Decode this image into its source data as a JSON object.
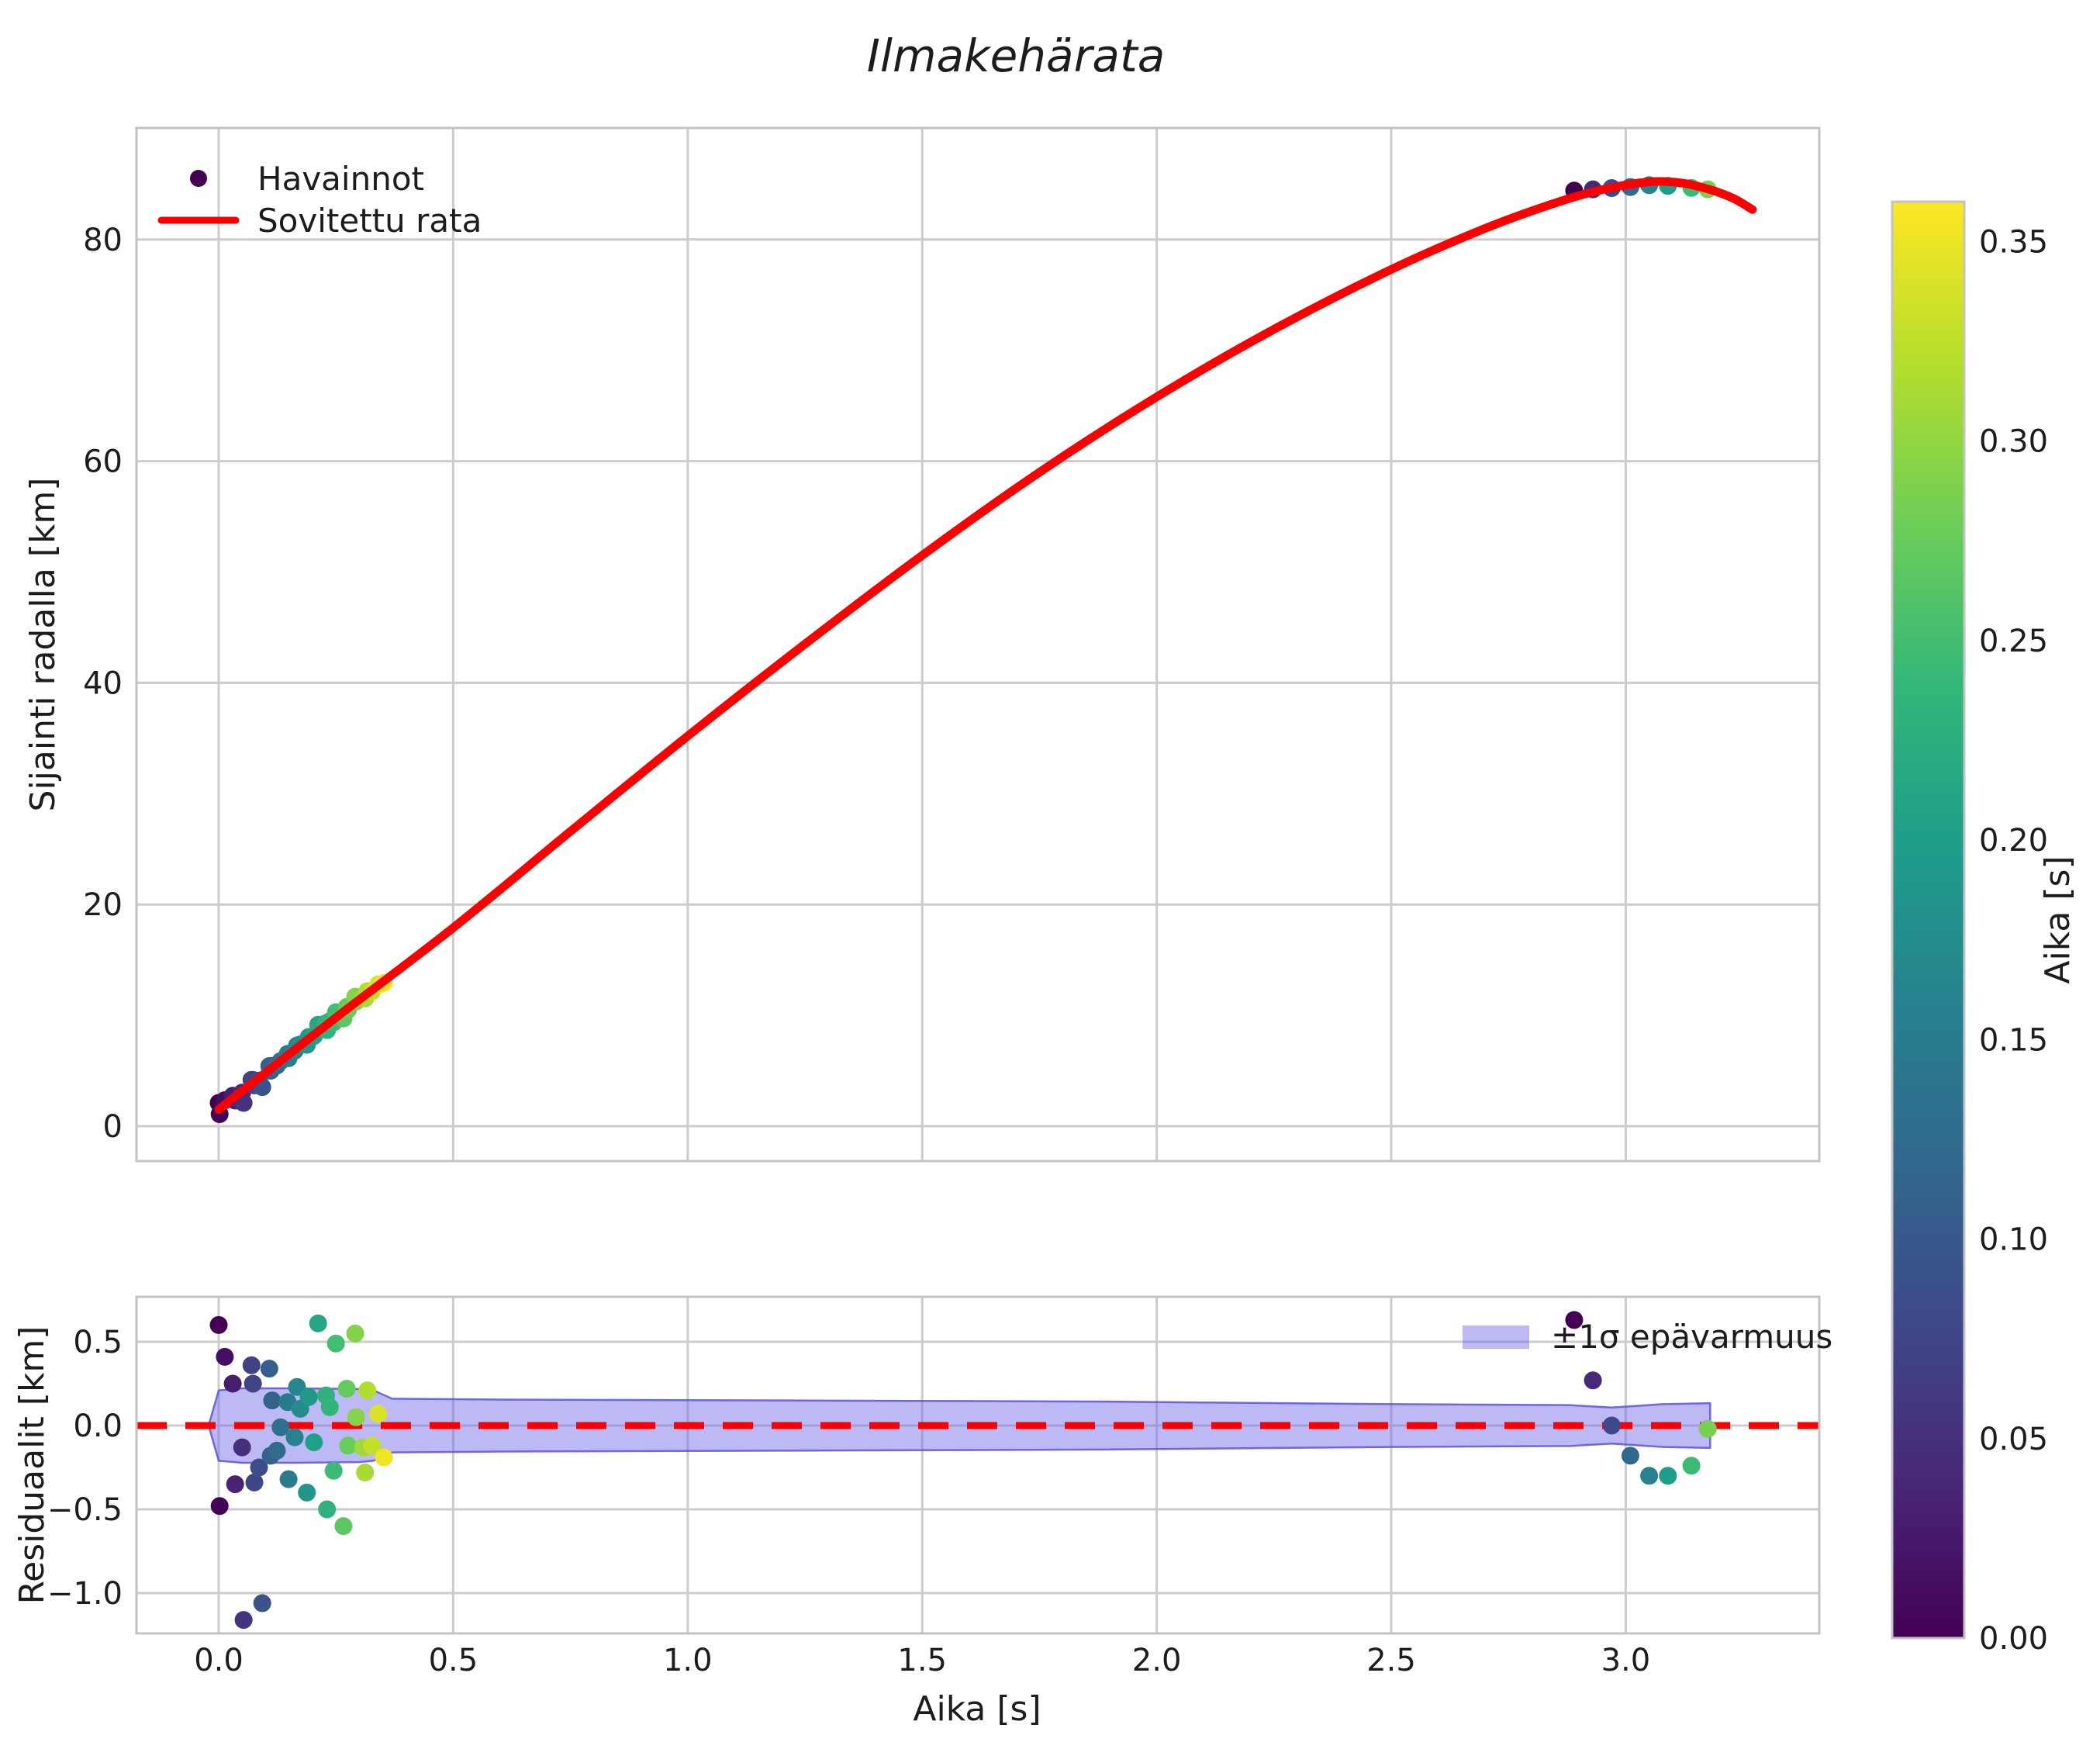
{
  "title": "Ilmakehärata",
  "colors": {
    "fit_line": "#fa0000",
    "zero_line": "#fa0000",
    "band_fill": "#6a63e8",
    "band_edge": "#5b52e0",
    "grid": "#cccccc",
    "spine": "#c3c3c3",
    "text": "#1c1c1c",
    "legend_marker": "#440154",
    "background": "#ffffff"
  },
  "chart_data": [
    {
      "type": "scatter",
      "panel": "trajectory",
      "ylabel": "Sijainti radalla [km]",
      "xlim": [
        -0.18,
        3.41
      ],
      "ylim": [
        -3.1,
        90.1
      ],
      "xticks": [
        0.0,
        0.5,
        1.0,
        1.5,
        2.0,
        2.5,
        3.0
      ],
      "xtick_labels": [],
      "yticks": [
        0,
        20,
        40,
        60,
        80
      ],
      "ytick_labels": [
        "0",
        "20",
        "40",
        "60",
        "80"
      ],
      "grid": true,
      "legend": [
        {
          "label": "Havainnot",
          "kind": "scatter-marker"
        },
        {
          "label": "Sovitettu rata",
          "kind": "line"
        }
      ],
      "fit_curve_note": "columns: t_s, position_km",
      "fit_curve": [
        [
          0.0,
          1.5
        ],
        [
          0.25,
          9.8
        ],
        [
          0.5,
          17.9
        ],
        [
          0.75,
          26.6
        ],
        [
          1.0,
          35.2
        ],
        [
          1.25,
          43.5
        ],
        [
          1.5,
          51.5
        ],
        [
          1.75,
          59.0
        ],
        [
          2.0,
          65.8
        ],
        [
          2.25,
          71.9
        ],
        [
          2.5,
          77.3
        ],
        [
          2.7,
          81.0
        ],
        [
          2.85,
          83.3
        ],
        [
          2.95,
          84.5
        ],
        [
          3.05,
          85.2
        ],
        [
          3.12,
          85.1
        ],
        [
          3.18,
          84.5
        ],
        [
          3.23,
          83.7
        ],
        [
          3.27,
          82.7
        ]
      ],
      "observations_note": "columns: t_s, residual_km (observed y = fit(t)+residual), color_value_s",
      "observations": [
        [
          0.0,
          0.6,
          0.0
        ],
        [
          0.002,
          -0.48,
          0.002
        ],
        [
          0.013,
          0.41,
          0.013
        ],
        [
          0.03,
          0.25,
          0.03
        ],
        [
          0.035,
          -0.35,
          0.035
        ],
        [
          0.05,
          -0.13,
          0.05
        ],
        [
          0.053,
          -1.16,
          0.053
        ],
        [
          0.07,
          0.36,
          0.07
        ],
        [
          0.073,
          0.25,
          0.073
        ],
        [
          0.076,
          -0.34,
          0.076
        ],
        [
          0.086,
          -0.25,
          0.086
        ],
        [
          0.093,
          -1.06,
          0.093
        ],
        [
          0.108,
          0.34,
          0.108
        ],
        [
          0.111,
          -0.18,
          0.111
        ],
        [
          0.114,
          0.15,
          0.114
        ],
        [
          0.124,
          -0.15,
          0.124
        ],
        [
          0.132,
          -0.01,
          0.132
        ],
        [
          0.147,
          0.14,
          0.147
        ],
        [
          0.149,
          -0.32,
          0.149
        ],
        [
          0.162,
          -0.07,
          0.162
        ],
        [
          0.167,
          0.23,
          0.167
        ],
        [
          0.174,
          0.1,
          0.174
        ],
        [
          0.188,
          -0.4,
          0.188
        ],
        [
          0.192,
          0.17,
          0.192
        ],
        [
          0.203,
          -0.1,
          0.203
        ],
        [
          0.212,
          0.61,
          0.212
        ],
        [
          0.229,
          0.18,
          0.229
        ],
        [
          0.231,
          -0.5,
          0.231
        ],
        [
          0.237,
          0.11,
          0.237
        ],
        [
          0.245,
          -0.27,
          0.245
        ],
        [
          0.25,
          0.49,
          0.25
        ],
        [
          0.266,
          -0.6,
          0.266
        ],
        [
          0.273,
          0.22,
          0.273
        ],
        [
          0.276,
          -0.12,
          0.276
        ],
        [
          0.291,
          0.55,
          0.291
        ],
        [
          0.293,
          0.05,
          0.293
        ],
        [
          0.308,
          -0.13,
          0.308
        ],
        [
          0.312,
          -0.28,
          0.312
        ],
        [
          0.317,
          0.21,
          0.317
        ],
        [
          0.327,
          -0.12,
          0.327
        ],
        [
          0.34,
          0.07,
          0.34
        ],
        [
          0.352,
          -0.19,
          0.352
        ],
        [
          2.89,
          0.63,
          0.0
        ],
        [
          2.93,
          0.27,
          0.04
        ],
        [
          2.97,
          0.0,
          0.08
        ],
        [
          3.01,
          -0.18,
          0.12
        ],
        [
          3.05,
          -0.3,
          0.16
        ],
        [
          3.09,
          -0.3,
          0.2
        ],
        [
          3.14,
          -0.24,
          0.245
        ],
        [
          3.175,
          -0.02,
          0.285
        ]
      ]
    },
    {
      "type": "scatter",
      "panel": "residuals",
      "xlabel": "Aika [s]",
      "ylabel": "Residuaalit [km]",
      "xlim": [
        -0.18,
        3.41
      ],
      "ylim": [
        -1.24,
        0.77
      ],
      "xticks": [
        0.0,
        0.5,
        1.0,
        1.5,
        2.0,
        2.5,
        3.0
      ],
      "xtick_labels": [
        "0.0",
        "0.5",
        "1.0",
        "1.5",
        "2.0",
        "2.5",
        "3.0"
      ],
      "yticks": [
        0.5,
        0.0,
        -0.5,
        -1.0
      ],
      "ytick_labels": [
        "0.5",
        "0.0",
        "−0.5",
        "−1.0"
      ],
      "grid": true,
      "zero_line": 0.0,
      "band": {
        "label": "±1σ epävarmuus",
        "points_note": "columns: t_s, half_width_km (band is symmetric about 0)",
        "points": [
          [
            0.0,
            0.21
          ],
          [
            0.05,
            0.222
          ],
          [
            0.16,
            0.222
          ],
          [
            0.3,
            0.218
          ],
          [
            0.33,
            0.21
          ],
          [
            0.37,
            0.16
          ],
          [
            0.6,
            0.155
          ],
          [
            1.2,
            0.15
          ],
          [
            1.9,
            0.143
          ],
          [
            2.5,
            0.128
          ],
          [
            2.88,
            0.122
          ],
          [
            2.97,
            0.108
          ],
          [
            3.08,
            0.128
          ],
          [
            3.18,
            0.134
          ]
        ]
      }
    },
    {
      "type": "colorbar",
      "label": "Aika [s]",
      "range": [
        0.0,
        0.36
      ],
      "ticks": [
        0.0,
        0.05,
        0.1,
        0.15,
        0.2,
        0.25,
        0.3,
        0.35
      ],
      "tick_labels": [
        "0.00",
        "0.05",
        "0.10",
        "0.15",
        "0.20",
        "0.25",
        "0.30",
        "0.35"
      ],
      "colormap": "viridis",
      "colormap_stops": [
        "#440154",
        "#482878",
        "#3e4989",
        "#31688e",
        "#26828e",
        "#1f9e89",
        "#35b779",
        "#6ece58",
        "#b5de2b",
        "#fde725"
      ]
    }
  ]
}
